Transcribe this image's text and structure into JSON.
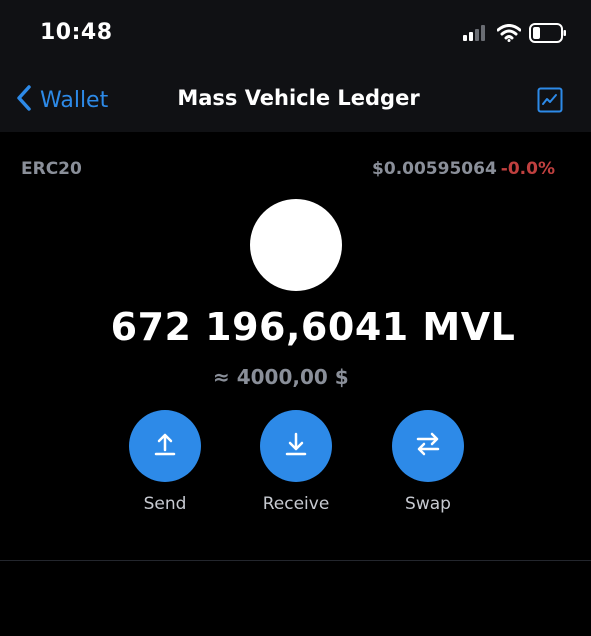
{
  "status_bar": {
    "time": "10:48",
    "icons": [
      "signal-icon",
      "wifi-icon",
      "battery-icon"
    ]
  },
  "nav": {
    "back_label": "Wallet",
    "title": "Mass Vehicle Ledger",
    "chart_icon": "chart-icon"
  },
  "token": {
    "standard": "ERC20",
    "price": "$0.00595064",
    "price_change": "-0.0%",
    "balance": "672 196,6041 MVL",
    "fiat_value": "≈ 4000,00 $"
  },
  "actions": [
    {
      "label": "Send",
      "icon": "send-icon"
    },
    {
      "label": "Receive",
      "icon": "receive-icon"
    },
    {
      "label": "Swap",
      "icon": "swap-icon"
    }
  ],
  "colors": {
    "accent": "#2d8ae8",
    "negative": "#c0403f",
    "muted": "#8a8f99",
    "background": "#000000",
    "bar_background": "#101114"
  }
}
